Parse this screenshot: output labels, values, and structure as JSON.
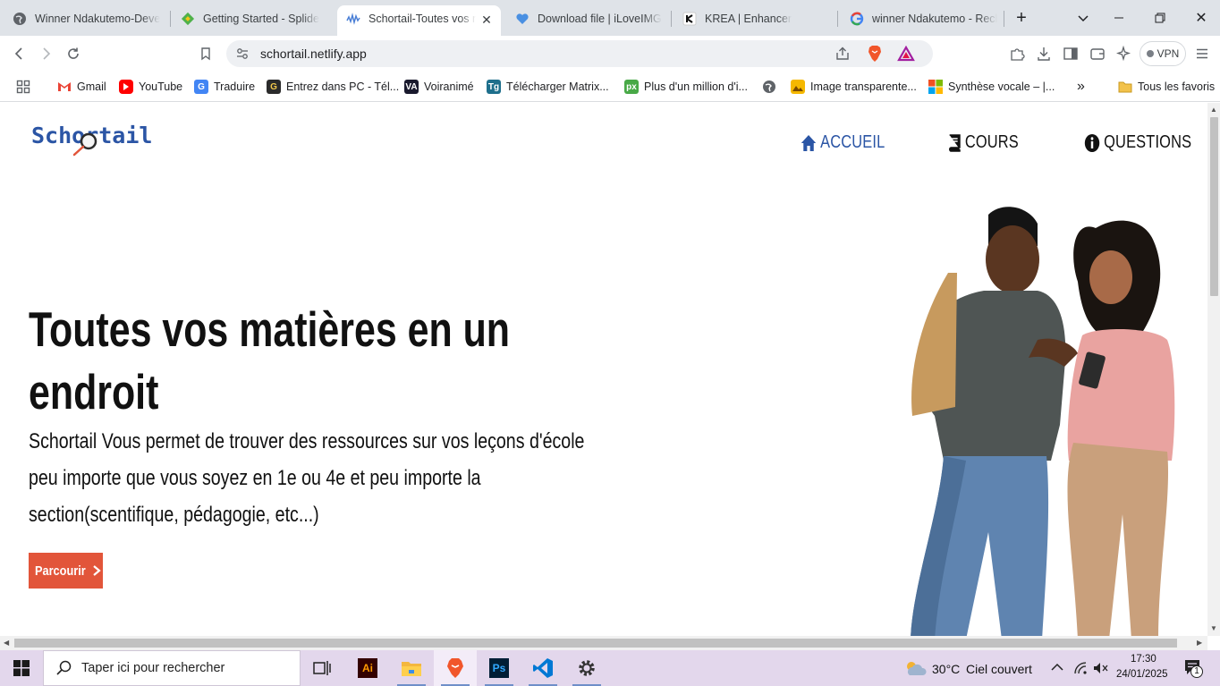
{
  "browser": {
    "tabs": [
      {
        "title": "Winner Ndakutemo-Deve",
        "icon": "globe-icon",
        "active": false
      },
      {
        "title": "Getting Started - Splide",
        "icon": "splide-icon",
        "active": false
      },
      {
        "title": "Schortail-Toutes vos m",
        "icon": "schortail-icon",
        "active": true
      },
      {
        "title": "Download file | iLoveIMG",
        "icon": "iloveimg-icon",
        "active": false
      },
      {
        "title": "KREA | Enhancer",
        "icon": "krea-icon",
        "active": false
      },
      {
        "title": "winner Ndakutemo - Rech",
        "icon": "google-icon",
        "active": false
      }
    ],
    "url": "schortail.netlify.app",
    "vpn_label": "VPN",
    "bookmarks": [
      {
        "label": "Gmail",
        "icon": "gmail-icon"
      },
      {
        "label": "YouTube",
        "icon": "youtube-icon"
      },
      {
        "label": "Traduire",
        "icon": "translate-icon"
      },
      {
        "label": "Entrez dans PC - Tél...",
        "icon": "g-icon"
      },
      {
        "label": "Voiranimé",
        "icon": "va-icon"
      },
      {
        "label": "Télécharger Matrix...",
        "icon": "tg-icon"
      },
      {
        "label": "Plus d'un million d'i...",
        "icon": "px-icon"
      },
      {
        "label": "",
        "icon": "globe-icon"
      },
      {
        "label": "Image transparente...",
        "icon": "image-icon"
      },
      {
        "label": "Synthèse vocale – |...",
        "icon": "microsoft-icon"
      }
    ],
    "all_bookmarks_label": "Tous les favoris"
  },
  "site": {
    "logo": "Schortail",
    "nav": [
      {
        "label": "ACCUEIL",
        "icon": "home-icon",
        "active": true
      },
      {
        "label": "COURS",
        "icon": "book-icon",
        "active": false
      },
      {
        "label": "QUESTIONS",
        "icon": "info-icon",
        "active": false
      }
    ],
    "hero": {
      "title_line1": "Toutes vos matières en un",
      "title_line2": "endroit",
      "text_line1": "Schortail Vous permet de trouver des ressources sur vos leçons d'école",
      "text_line2": "peu importe que vous soyez en 1e ou 4e et peu importe la",
      "text_line3": "section(scentifique, pédagogie, etc...)",
      "cta": "Parcourir"
    },
    "colors": {
      "brand": "#2b55a5",
      "cta": "#e2553a",
      "nav_active": "#2b55a5"
    }
  },
  "taskbar": {
    "search_placeholder": "Taper ici pour rechercher",
    "apps": [
      "task-view-icon",
      "illustrator-icon",
      "file-explorer-icon",
      "brave-icon",
      "photoshop-icon",
      "vscode-icon",
      "settings-icon"
    ],
    "weather_temp": "30°C",
    "weather_text": "Ciel couvert",
    "time": "17:30",
    "date": "24/01/2025",
    "notification_count": "1"
  }
}
